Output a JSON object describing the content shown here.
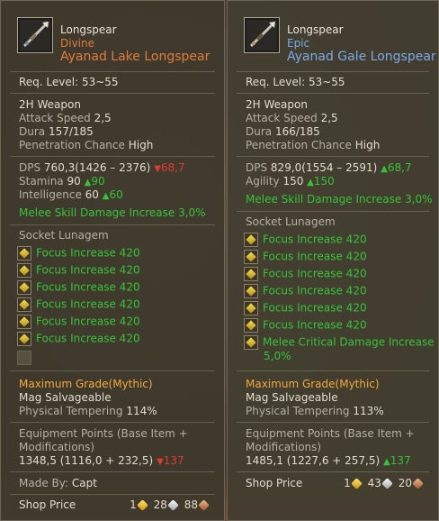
{
  "left": {
    "item_type": "Longspear",
    "grade": "Divine",
    "name": "Ayanad Lake Longspear",
    "req_level": "Req. Level: 53~55",
    "weapon_type": "2H Weapon",
    "attack_speed_label": "Attack Speed",
    "attack_speed": "2,5",
    "dura_label": "Dura",
    "dura": "157/185",
    "pen_label": "Penetration Chance",
    "pen": "High",
    "dps_label": "DPS",
    "dps": "760,3(1426 – 2376)",
    "dps_diff": "68,7",
    "stamina_label": "Stamina",
    "stamina": "90",
    "stamina_diff": "90",
    "int_label": "Intelligence",
    "int": "60",
    "int_diff": "60",
    "bonus": "Melee Skill Damage Increase 3,0%",
    "socket_title": "Socket Lunagem",
    "lunagems": [
      "Focus Increase 420",
      "Focus Increase 420",
      "Focus Increase 420",
      "Focus Increase 420",
      "Focus Increase 420",
      "Focus Increase 420"
    ],
    "max_grade": "Maximum Grade(Mythic)",
    "salvage": "Mag Salvageable",
    "tempering_label": "Physical Tempering",
    "tempering": "114%",
    "equip_points_label": "Equipment Points (Base Item + Modifications)",
    "equip_points": "1348,5 (1116,0 + 232,5)",
    "equip_diff": "137",
    "made_by_label": "Made By:",
    "made_by": "Capt",
    "shop_label": "Shop Price",
    "gold": "1",
    "silver": "28",
    "copper": "88"
  },
  "right": {
    "item_type": "Longspear",
    "grade": "Epic",
    "name": "Ayanad Gale Longspear",
    "req_level": "Req. Level: 53~55",
    "weapon_type": "2H Weapon",
    "attack_speed_label": "Attack Speed",
    "attack_speed": "2,5",
    "dura_label": "Dura",
    "dura": "166/185",
    "pen_label": "Penetration Chance",
    "pen": "High",
    "dps_label": "DPS",
    "dps": "829,0(1554 – 2591)",
    "dps_diff": "68,7",
    "agi_label": "Agility",
    "agi": "150",
    "agi_diff": "150",
    "bonus": "Melee Skill Damage Increase 3,0%",
    "socket_title": "Socket Lunagem",
    "lunagems": [
      "Focus Increase 420",
      "Focus Increase 420",
      "Focus Increase 420",
      "Focus Increase 420",
      "Focus Increase 420",
      "Focus Increase 420"
    ],
    "lunagem_extra": "Melee Critical Damage Increase",
    "lunagem_extra_2": "5,0%",
    "max_grade": "Maximum Grade(Mythic)",
    "salvage": "Mag Salvageable",
    "tempering_label": "Physical Tempering",
    "tempering": "113%",
    "equip_points_label": "Equipment Points (Base Item + Modifications)",
    "equip_points": "1485,1 (1227,6 + 257,5)",
    "equip_diff": "137",
    "shop_label": "Shop Price",
    "gold": "1",
    "silver": "43",
    "copper": "20"
  },
  "colors": {
    "divine": "#e07a3a",
    "epic": "#7aa8e8",
    "green": "#36c23a",
    "red": "#e03a34",
    "gold": "#f2a93a"
  },
  "icons": {
    "weapon": "longspear-icon",
    "lunagem": "lunagem-icon",
    "gold_coin": "gold-coin-icon",
    "silver_coin": "silver-coin-icon",
    "copper_coin": "copper-coin-icon"
  }
}
